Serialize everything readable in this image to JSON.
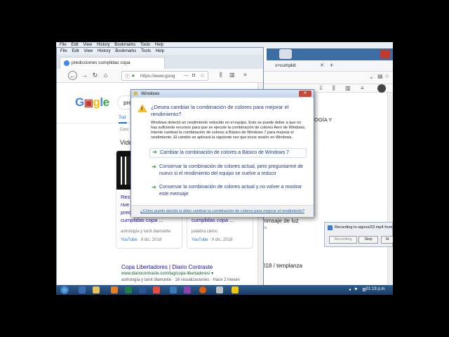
{
  "back_window": {
    "menu": [
      "File",
      "Edit",
      "View",
      "History",
      "Bookmarks",
      "Tools",
      "Help"
    ],
    "tab_title": "s+cumplid",
    "heading_partial": "OGÍA Y",
    "result_snippet_1": "mmsaje de luz",
    "result_snippet_2": "018 / templanza",
    "bottom_text": "astrología y tarot diamante · 16 visualizaciones · Hace 2 meses",
    "side_label": "es"
  },
  "front_browser": {
    "menu": [
      "File",
      "Edit",
      "View",
      "History",
      "Bookmarks",
      "Tools",
      "Help"
    ],
    "tab_title": "predicciones cumplidas copa",
    "url": "https://www.goog",
    "search_query": "pre",
    "tab_all": "Tod",
    "stats_partial": "Cerc",
    "videos_partial": "Vide",
    "card1": {
      "title_lines": [
        "Res",
        "rive",
        "pred",
        "cumplidas copa ..."
      ],
      "channel": "astrología y tarot diamante",
      "source": "YouTube",
      "date": "9 dic. 2018"
    },
    "card2": {
      "title_lines": [
        "cumplidas copa ..."
      ],
      "channel": "palabra cielos",
      "source": "YouTube",
      "date": "9 dic. 2018"
    },
    "result": {
      "title": "Copa Libertadores | Diario Contraste",
      "url": "www.diariocontraste.com/tag/copa-libertadores/",
      "snippet": "astrología y tarot diamante · 16 visualizaciones · Hace 2 meses"
    }
  },
  "dialog": {
    "title": "Windows",
    "heading": "¿Desea cambiar la combinación de colores para mejorar el rendimiento?",
    "body": "Windows detectó un rendimiento reducido en el equipo. Esto se puede deber a que no hay suficiente recursos para que se ejecute la combinación de colores Aero de Windows. Intente cambiar la combinación de colores a Básico de Windows 7 para mejorar el rendimiento. El cambio se aplicará la siguiente vez que inicie sesión en Windows.",
    "options": [
      "Cambiar la combinación de colores a Básico de Windows 7",
      "Conservar la combinación de colores actual, pero preguntarme de nuevo si el rendimiento del equipo se vuelve a reducir",
      "Conservar la combinación de colores actual y no volver a mostrar este mensaje"
    ],
    "footer_link": "¿Cómo puedo decidir si debo cambiar la combinación de colores para mejorar el rendimiento?"
  },
  "recording": {
    "title": "Recording to signos/22.mp4 from",
    "status_btn": "Recording",
    "stop_btn": "Stop",
    "other_btn": "St"
  },
  "taskbar": {
    "time": "01:19 p.m."
  },
  "colors": {
    "desktop": "#3c6ea5",
    "dialog_heading": "#1e3c8c",
    "option_arrow": "#1f9a2a",
    "link": "#1a0dab",
    "taskbar": "#1b3b63"
  }
}
